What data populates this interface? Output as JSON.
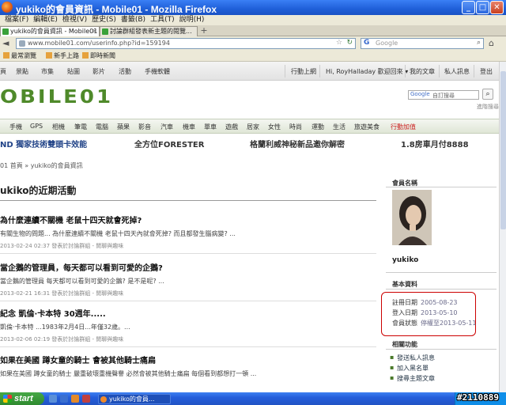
{
  "window": {
    "title": "yukiko的會員資訊 - Mobile01 - Mozilla Firefox"
  },
  "menubar": [
    "檔案(F)",
    "編輯(E)",
    "檢視(V)",
    "歷史(S)",
    "書籤(B)",
    "工具(T)",
    "說明(H)"
  ],
  "tabs": [
    {
      "label": "yukiko的會員資訊 - Mobile01",
      "active": true
    },
    {
      "label": "討論群組發表新主題的閱覽...",
      "active": false
    }
  ],
  "navbar": {
    "url": "www.mobile01.com/userinfo.php?id=159194",
    "search_placeholder": "Google",
    "search_engine": "G"
  },
  "bookmarks": [
    "最常瀏覽",
    "新手上路",
    "即時新聞"
  ],
  "site_nav": {
    "items": [
      "頁",
      "景點",
      "市集",
      "貼圖",
      "影片",
      "活動",
      "手機軟體"
    ],
    "right_items": [
      "行動上網",
      "Hi, RoyHalladay 歡迎回來 ▾",
      "我的文章",
      "私人訊息",
      "登出"
    ]
  },
  "logo": "OBILE01",
  "google_search": {
    "label": "Google",
    "placeholder": "自訂搜尋",
    "advanced": "進階搜尋"
  },
  "categories": [
    "手機",
    "GPS",
    "相機",
    "筆電",
    "電腦",
    "蘋果",
    "影音",
    "汽車",
    "機車",
    "單車",
    "遊戲",
    "居家",
    "女性",
    "時尚",
    "運動",
    "生活",
    "旅遊美食",
    "行動加值"
  ],
  "promos": [
    "ND 獨家技術雙頭卡效能",
    "全方位FORESTER",
    "格蘭利威神秘新品邀你解密",
    "1.8房車月付8888"
  ],
  "breadcrumb": "01 首頁 » yukiko的會員資訊",
  "main_title": "ukiko的近期活動",
  "posts": [
    {
      "title": "為什麼連續不關機 老鼠十四天就會死掉?",
      "excerpt": "有關生物的問題... 為什麼連續不關機 老鼠十四天內就會死掉? 而且都發生腦病變? ...",
      "meta": "2013-02-24 02:37 發表於討論群組 - 閒聊與趣味"
    },
    {
      "title": "當企鵝的管理員，每天都可以看到可愛的企鵝?",
      "excerpt": "當企鵝的管理員 每天都可以看到可愛的企鵝? 是不是呢? ...",
      "meta": "2013-02-21 16:31 發表於討論群組 - 閒聊與趣味"
    },
    {
      "title": "紀念 凱倫·卡本特 30週年.....",
      "excerpt": "凱倫·卡本特 ...1983年2月4日...年僅32歲。...",
      "meta": "2013-02-06 02:19 發表於討論群組 - 閒聊與趣味"
    },
    {
      "title": "如果在美國 蹲女童的騎士 會被其他騎士痛扁",
      "excerpt": "如果在美國 蹲女童的騎士 嚴重破壞重機聲譽 必然會被其他騎士痛扁 每個看到都想打一頓 ...",
      "meta": ""
    }
  ],
  "sidebar": {
    "member_name_heading": "會員名稱",
    "username": "yukiko",
    "basic_info_heading": "基本資料",
    "info": [
      {
        "label": "註冊日期",
        "value": "2005-08-23"
      },
      {
        "label": "登入日期",
        "value": "2013-05-10"
      },
      {
        "label": "會員狀態",
        "value": "停權至2013-05-11"
      }
    ],
    "functions_heading": "相關功能",
    "functions": [
      "發送私人訊息",
      "加入黑名單",
      "搜尋主題文章"
    ]
  },
  "taskbar": {
    "start_label": "start",
    "task_label": "yukiko的會員...",
    "post_id": "#2110889"
  }
}
